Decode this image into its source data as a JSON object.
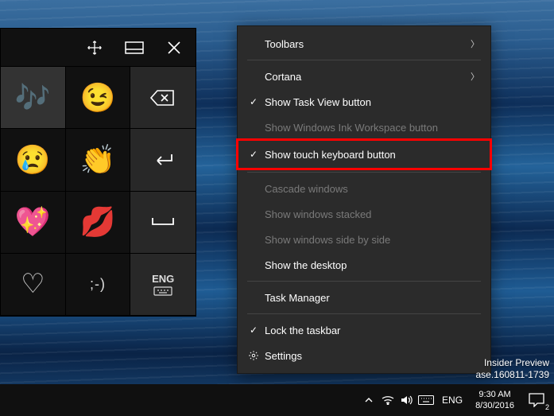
{
  "touch_keyboard": {
    "music_emoji": "🎶",
    "wink_emoji": "😉",
    "cry_emoji": "😢",
    "clap_emoji": "👏",
    "heart_emoji": "💖",
    "kiss_emoji": "💋",
    "outline_heart_emoji": "♡",
    "text_face": ";-)",
    "lang_label": "ENG"
  },
  "menu": {
    "toolbars": "Toolbars",
    "cortana": "Cortana",
    "show_taskview": "Show Task View button",
    "show_ink": "Show Windows Ink Workspace button",
    "show_touch_kb": "Show touch keyboard button",
    "cascade": "Cascade windows",
    "stacked": "Show windows stacked",
    "sidebyside": "Show windows side by side",
    "show_desktop": "Show the desktop",
    "task_manager": "Task Manager",
    "lock_taskbar": "Lock the taskbar",
    "settings": "Settings"
  },
  "watermark": {
    "line1": "Insider Preview",
    "line2": "ase.160811-1739"
  },
  "taskbar": {
    "lang": "ENG",
    "time": "9:30 AM",
    "date": "8/30/2016",
    "notif_count": "2"
  }
}
